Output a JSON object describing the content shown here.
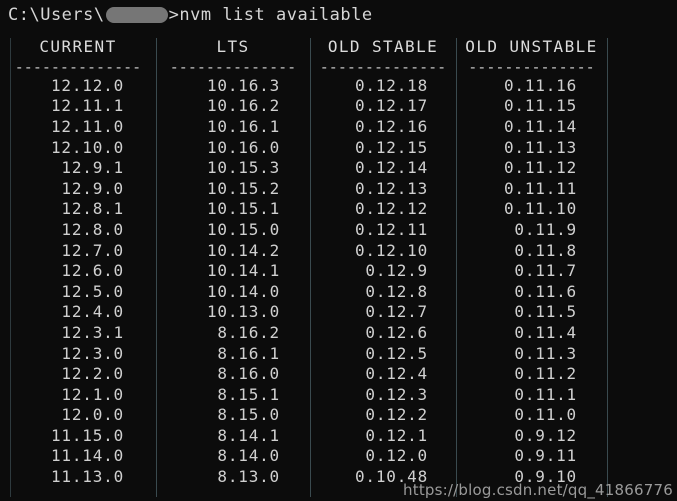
{
  "terminal": {
    "background_color": "#0c0c0c",
    "text_color": "#d0d0d0",
    "rule_color": "#3a4a4f"
  },
  "prompt": {
    "prefix": "C:\\Users\\",
    "redacted_user": "",
    "suffix": ">",
    "command": "nvm list available"
  },
  "table": {
    "headers": [
      "CURRENT",
      "LTS",
      "OLD STABLE",
      "OLD UNSTABLE"
    ],
    "separator": "--------------",
    "rows": [
      [
        "12.12.0",
        "10.16.3",
        "0.12.18",
        "0.11.16"
      ],
      [
        "12.11.1",
        "10.16.2",
        "0.12.17",
        "0.11.15"
      ],
      [
        "12.11.0",
        "10.16.1",
        "0.12.16",
        "0.11.14"
      ],
      [
        "12.10.0",
        "10.16.0",
        "0.12.15",
        "0.11.13"
      ],
      [
        "12.9.1",
        "10.15.3",
        "0.12.14",
        "0.11.12"
      ],
      [
        "12.9.0",
        "10.15.2",
        "0.12.13",
        "0.11.11"
      ],
      [
        "12.8.1",
        "10.15.1",
        "0.12.12",
        "0.11.10"
      ],
      [
        "12.8.0",
        "10.15.0",
        "0.12.11",
        "0.11.9"
      ],
      [
        "12.7.0",
        "10.14.2",
        "0.12.10",
        "0.11.8"
      ],
      [
        "12.6.0",
        "10.14.1",
        "0.12.9",
        "0.11.7"
      ],
      [
        "12.5.0",
        "10.14.0",
        "0.12.8",
        "0.11.6"
      ],
      [
        "12.4.0",
        "10.13.0",
        "0.12.7",
        "0.11.5"
      ],
      [
        "12.3.1",
        "8.16.2",
        "0.12.6",
        "0.11.4"
      ],
      [
        "12.3.0",
        "8.16.1",
        "0.12.5",
        "0.11.3"
      ],
      [
        "12.2.0",
        "8.16.0",
        "0.12.4",
        "0.11.2"
      ],
      [
        "12.1.0",
        "8.15.1",
        "0.12.3",
        "0.11.1"
      ],
      [
        "12.0.0",
        "8.15.0",
        "0.12.2",
        "0.11.0"
      ],
      [
        "11.15.0",
        "8.14.1",
        "0.12.1",
        "0.9.12"
      ],
      [
        "11.14.0",
        "8.14.0",
        "0.12.0",
        "0.9.11"
      ],
      [
        "11.13.0",
        "8.13.0",
        "0.10.48",
        "0.9.10"
      ]
    ]
  },
  "watermark": {
    "text": "https://blog.csdn.net/qq_41866776"
  }
}
